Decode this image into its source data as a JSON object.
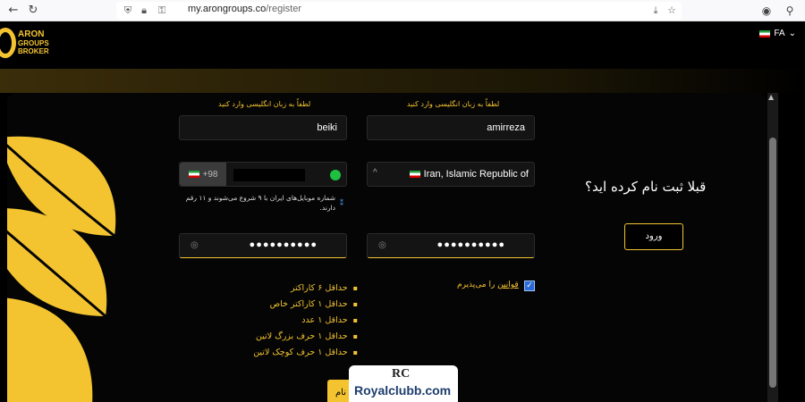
{
  "browser": {
    "url_host": "my.arongroups.co",
    "url_path": "/register"
  },
  "header": {
    "logo_line1": "ARON",
    "logo_line2": "GROUPS",
    "logo_line3": "BROKER",
    "lang_label": "FA"
  },
  "form": {
    "english_hint": "لطفاً به زبان انگلیسی وارد کنید",
    "last_name_value": "beiki",
    "first_name_value": "amirreza",
    "phone_prefix": "+98",
    "country_value": "Iran, Islamic Republic of",
    "phone_note": "شماره موبایل‌های ایران با ۹ شروع می‌شوند و ۱۱ رقم دارند.",
    "password_dots": "●●●●●●●●●●",
    "confirm_dots": "●●●●●●●●●●",
    "terms_link": "قوانین",
    "terms_text": "را می‌پذیرم",
    "rules": [
      "حداقل ۶ کاراکتر",
      "حداقل ۱ کاراکتر خاص",
      "حداقل ۱ عدد",
      "حداقل ۱ حرف بزرگ لاتین",
      "حداقل ۱ حرف کوچک لاتین"
    ],
    "submit_label": "نام"
  },
  "side": {
    "question": "قبلا ثبت نام کرده اید؟",
    "login_label": "ورود"
  },
  "watermark": {
    "mark": "RC",
    "site": "Royalclubb.com"
  }
}
